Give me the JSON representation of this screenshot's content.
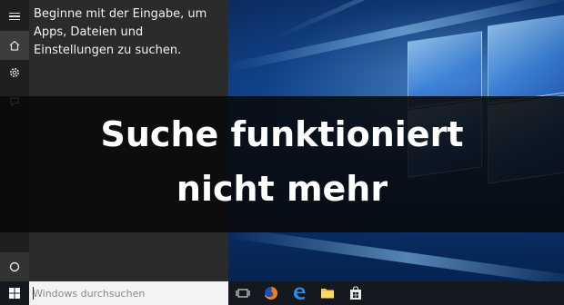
{
  "start_menu": {
    "hint_text": "Beginne mit der Eingabe, um\nApps, Dateien und\nEinstellungen zu suchen."
  },
  "banner": {
    "title": "Suche funktioniert\nnicht mehr"
  },
  "taskbar": {
    "search_placeholder": "Windows durchsuchen",
    "icons": [
      "start-icon",
      "task-view-icon",
      "firefox-icon",
      "edge-icon",
      "file-explorer-icon",
      "store-icon"
    ]
  },
  "colors": {
    "start_panel": "#2b2b2b",
    "start_rail": "#1f1f1f",
    "taskbar": "#15191f",
    "banner_bg": "#080808",
    "wallpaper_accent": "#0a3a80"
  }
}
